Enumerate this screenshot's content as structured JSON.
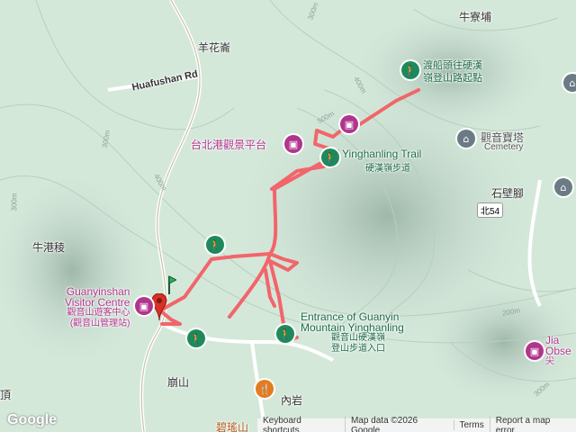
{
  "places": {
    "yangua": "羊花崙",
    "niuliao": "牛寮埔",
    "niugang": "牛港稜",
    "shibijiao": "石壁腳",
    "bengshan": "崩山",
    "neiyan": "內岩",
    "biyaoshan": "碧瑤山",
    "ding": "頂"
  },
  "roads": {
    "huafushan": "Huafushan Rd",
    "bei54": "北54"
  },
  "pois": {
    "trailhead_line1": "渡船頭往硬漢",
    "trailhead_line2": "嶺登山路起點",
    "taipei_port": "台北港觀景平台",
    "yinghanling_en": "Yinghanling Trail",
    "yinghanling_zh": "硬漢嶺步道",
    "guanyin_temple": "觀音寶塔",
    "cemetery": "Cemetery",
    "visitor_en_1": "Guanyinshan",
    "visitor_en_2": "Visitor Centre",
    "visitor_zh_1": "觀音山遊客中心",
    "visitor_zh_2": "(觀音山管理站)",
    "entrance_en_1": "Entrance of Guanyin",
    "entrance_en_2": "Mountain Yinghanling",
    "entrance_zh_1": "觀音山硬漢嶺",
    "entrance_zh_2": "登山步道入口",
    "obs_1": "Jia",
    "obs_2": "Obse",
    "obs_3": "尖"
  },
  "contours": {
    "c300a": "300m",
    "c300b": "300m",
    "c300c": "300m",
    "c400a": "400m",
    "c400b": "400m",
    "c500": "500m",
    "c200": "200m",
    "c300d": "300m"
  },
  "attribution": {
    "shortcuts": "Keyboard shortcuts",
    "mapdata": "Map data ©2026 Google",
    "terms": "Terms",
    "report": "Report a map error"
  },
  "logo": "Google",
  "colors": {
    "track": "#f2656b",
    "terrain": "#cfe3d6",
    "poi_pink": "#b0358c",
    "poi_green": "#1e8a5c"
  }
}
